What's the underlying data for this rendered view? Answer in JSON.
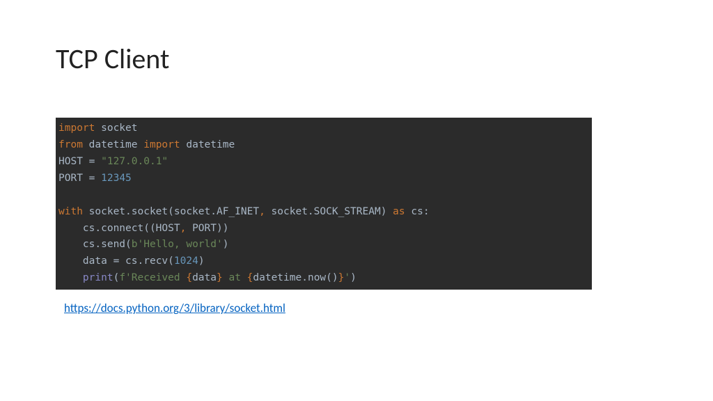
{
  "title": "TCP Client",
  "code": {
    "l1_import": "import",
    "l1_socket": " socket",
    "l2_from": "from",
    "l2_datetime1": " datetime ",
    "l2_import": "import",
    "l2_datetime2": " datetime",
    "l3_host": "HOST ",
    "l3_eq": "=",
    "l3_val": " \"127.0.0.1\"",
    "l4_port": "PORT ",
    "l4_eq": "=",
    "l4_sp": " ",
    "l4_val": "12345",
    "l6_with": "with",
    "l6_a": " socket.socket(socket.AF_INET",
    "l6_c1": ",",
    "l6_b": " socket.SOCK_STREAM) ",
    "l6_as": "as",
    "l6_cs": " cs:",
    "l7_a": "    cs.connect((HOST",
    "l7_c": ",",
    "l7_b": " PORT))",
    "l8_a": "    cs.send(",
    "l8_s": "b'Hello, world'",
    "l8_b": ")",
    "l9_a": "    data ",
    "l9_eq": "=",
    "l9_b": " cs.recv(",
    "l9_n": "1024",
    "l9_c": ")",
    "l10_ind": "    ",
    "l10_print": "print",
    "l10_op": "(",
    "l10_s1": "f'Received ",
    "l10_b1": "{",
    "l10_d": "data",
    "l10_b2": "}",
    "l10_s2": " at ",
    "l10_b3": "{",
    "l10_dt": "datetime.now()",
    "l10_b4": "}",
    "l10_s3": "'",
    "l10_cp": ")"
  },
  "link": "https://docs.python.org/3/library/socket.html"
}
